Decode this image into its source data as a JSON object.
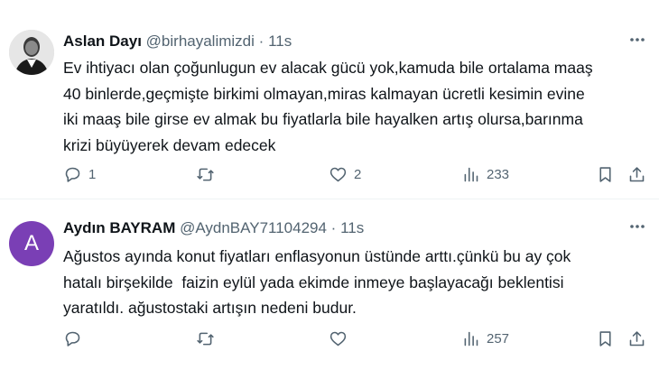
{
  "tweets": [
    {
      "author_name": "Aslan Dayı",
      "handle": "@birhayalimizdi",
      "separator": "·",
      "time": "11s",
      "lines": [
        "Ev ihtiyacı olan çoğunlugun ev alacak gücü yok,kamuda bile ortalama maaş",
        "40 binlerde,geçmişte birkimi olmayan,miras kalmayan ücretli kesimin evine",
        "iki maaş bile girse ev almak bu fiyatlarla bile hayalken artış olursa,barınma",
        "krizi büyüyerek devam edecek"
      ],
      "reply_count": "1",
      "retweet_count": "",
      "like_count": "2",
      "view_count": "233",
      "more_icon": "more-horizontal-icon"
    },
    {
      "author_name": "Aydın BAYRAM",
      "handle": "@AydnBAY71104294",
      "separator": "·",
      "time": "11s",
      "avatar_letter": "A",
      "lines": [
        "Ağustos ayında konut fiyatları enflasyonun üstünde arttı.çünkü bu ay çok",
        "hatalı birşekilde  faizin eylül yada ekimde inmeye başlayacağı beklentisi",
        "yaratıldı. ağustostaki artışın nedeni budur."
      ],
      "reply_count": "",
      "retweet_count": "",
      "like_count": "",
      "view_count": "257",
      "more_icon": "more-horizontal-icon"
    }
  ],
  "colors": {
    "text": "#0f1419",
    "secondary": "#536471",
    "divider": "#eff3f4",
    "avatar_purple": "#7a3fb5"
  }
}
